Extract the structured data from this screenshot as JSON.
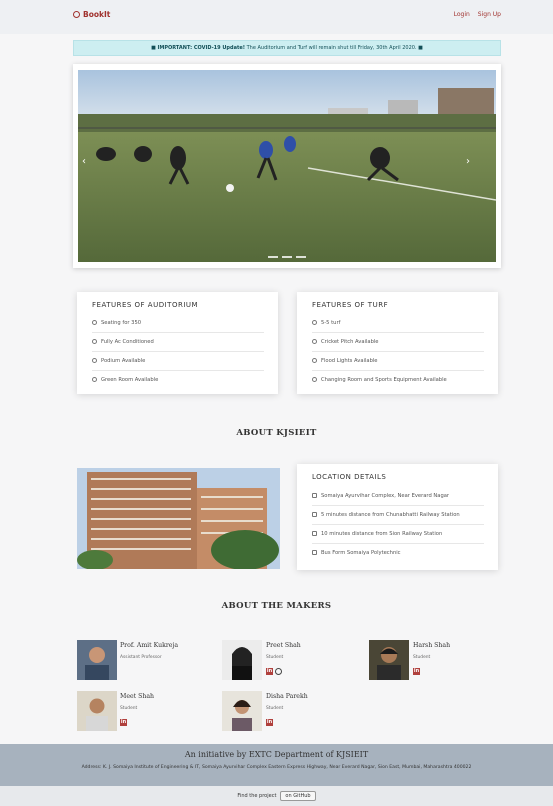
{
  "nav": {
    "brand": "BookIt",
    "login": "Login",
    "signup": "Sign Up"
  },
  "alert": {
    "strong": "IMPORTANT: COVID-19 Update!",
    "message": "The Auditorium and Turf will remain shut till Friday, 30th April 2020."
  },
  "auditorium": {
    "title": "FEATURES OF AUDITORIUM",
    "items": [
      "Seating for 350",
      "Fully Ac Conditioned",
      "Podium Available",
      "Green Room Available"
    ]
  },
  "turf": {
    "title": "FEATURES OF TURF",
    "items": [
      "5-5 turf",
      "Cricket Pitch Available",
      "Flood Lights Available",
      "Changing Room and Sports Equipment Available"
    ]
  },
  "about": {
    "title": "ABOUT KJSIEIT"
  },
  "location": {
    "title": "LOCATION DETAILS",
    "items": [
      "Somaiya Ayurvihar Complex, Near Everard Nagar",
      "5 minutes distance from Chunabhatti Railway Station",
      "10 minutes distance from Sion Railway Station",
      "Bus Form Somaiya Polytechnic"
    ]
  },
  "makers": {
    "title": "ABOUT THE MAKERS",
    "people": [
      {
        "name": "Prof. Amit Kukreja",
        "role": "Assistant Professor"
      },
      {
        "name": "Preet Shah",
        "role": "Student"
      },
      {
        "name": "Harsh Shah",
        "role": "Student"
      },
      {
        "name": "Meet Shah",
        "role": "Student"
      },
      {
        "name": "Disha Parekh",
        "role": "Student"
      }
    ]
  },
  "footer": {
    "title": "An initiative by EXTC Department of KJSIEIT",
    "address": "Address: K. J. Somaiya Institute of Engineering & IT, Somaiya Ayurvihar Complex Eastern Express Highway, Near Everard Nagar, Sion East, Mumbai, Maharashtra 400022",
    "find": "Find the project",
    "github": "on GitHub"
  },
  "colors": {
    "brand": "#a0322e",
    "alert_bg": "#cdeef1",
    "footer_bg": "#a7b2be"
  }
}
